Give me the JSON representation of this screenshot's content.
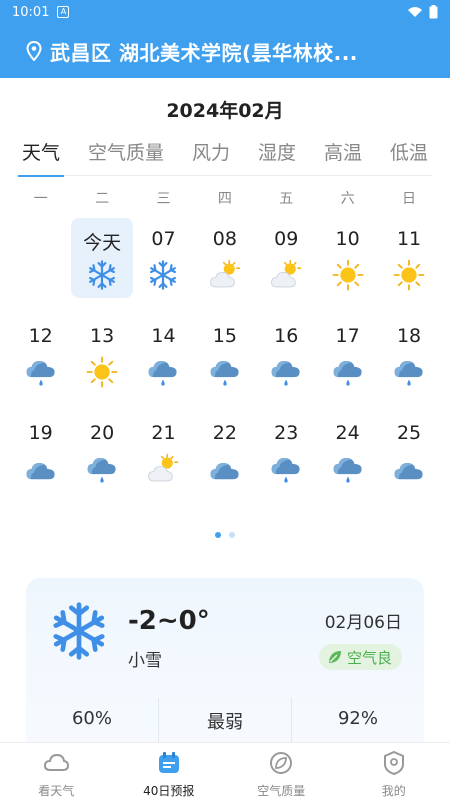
{
  "status": {
    "time": "10:01"
  },
  "header": {
    "location": "武昌区 湖北美术学院(昙华林校..."
  },
  "calendar": {
    "month_title": "2024年02月",
    "tabs": [
      "天气",
      "空气质量",
      "风力",
      "湿度",
      "高温",
      "低温"
    ],
    "weekdays": [
      "一",
      "二",
      "三",
      "四",
      "五",
      "六",
      "日"
    ],
    "rows": [
      [
        null,
        {
          "label": "今天",
          "icon": "snow-icon",
          "today": true
        },
        {
          "label": "07",
          "icon": "snow-icon"
        },
        {
          "label": "08",
          "icon": "partly-cloudy-icon"
        },
        {
          "label": "09",
          "icon": "partly-cloudy-icon"
        },
        {
          "label": "10",
          "icon": "sun-icon"
        },
        {
          "label": "11",
          "icon": "sun-icon"
        }
      ],
      [
        {
          "label": "12",
          "icon": "rain-icon"
        },
        {
          "label": "13",
          "icon": "sun-icon"
        },
        {
          "label": "14",
          "icon": "rain-icon"
        },
        {
          "label": "15",
          "icon": "rain-icon"
        },
        {
          "label": "16",
          "icon": "rain-icon"
        },
        {
          "label": "17",
          "icon": "rain-icon"
        },
        {
          "label": "18",
          "icon": "rain-icon"
        }
      ],
      [
        {
          "label": "19",
          "icon": "cloud-icon"
        },
        {
          "label": "20",
          "icon": "rain-icon"
        },
        {
          "label": "21",
          "icon": "partly-cloudy-icon"
        },
        {
          "label": "22",
          "icon": "cloud-icon"
        },
        {
          "label": "23",
          "icon": "rain-icon"
        },
        {
          "label": "24",
          "icon": "rain-icon"
        },
        {
          "label": "25",
          "icon": "cloud-icon"
        }
      ]
    ]
  },
  "detail": {
    "temp": "-2~0°",
    "condition": "小雪",
    "date": "02月06日",
    "air_quality": "空气良",
    "stats": [
      "60%",
      "最弱",
      "92%"
    ]
  },
  "nav": [
    {
      "label": "看天气",
      "icon": "weather-icon"
    },
    {
      "label": "40日预报",
      "icon": "calendar-icon",
      "active": true
    },
    {
      "label": "空气质量",
      "icon": "leaf-icon"
    },
    {
      "label": "我的",
      "icon": "profile-icon"
    }
  ],
  "colors": {
    "accent": "#3fa0ef",
    "good_air": "#4caf50"
  }
}
